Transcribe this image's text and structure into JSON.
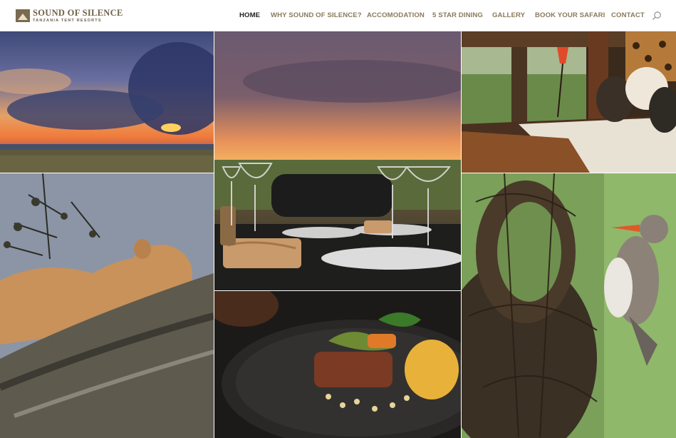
{
  "brand": {
    "name": "SOUND OF SILENCE",
    "tagline": "TANZANIA TENT RESORTS",
    "logo_icon": "tent-logo-icon"
  },
  "nav": {
    "items": [
      {
        "label": "HOME",
        "active": true
      },
      {
        "label": "WHY SOUND OF SILENCE?",
        "active": false
      },
      {
        "label": "ACCOMODATION",
        "active": false
      },
      {
        "label": "5 STAR DINING",
        "active": false
      },
      {
        "label": "GALLERY",
        "active": false
      },
      {
        "label": "BOOK YOUR SAFARI",
        "active": false
      },
      {
        "label": "CONTACT",
        "active": false
      }
    ],
    "search_icon": "search-icon"
  },
  "gallery": {
    "photos": [
      {
        "subject": "savanna-sunset-storm-clouds"
      },
      {
        "subject": "candlelit-dinner-table-at-sunset"
      },
      {
        "subject": "tent-bedroom-interior"
      },
      {
        "subject": "lioness-sleeping-in-tree"
      },
      {
        "subject": "plated-gourmet-dish"
      },
      {
        "subject": "weaver-bird-at-nest"
      }
    ]
  },
  "colors": {
    "nav_text": "#8a7a5c",
    "nav_active": "#222222",
    "brand": "#6e6148"
  }
}
